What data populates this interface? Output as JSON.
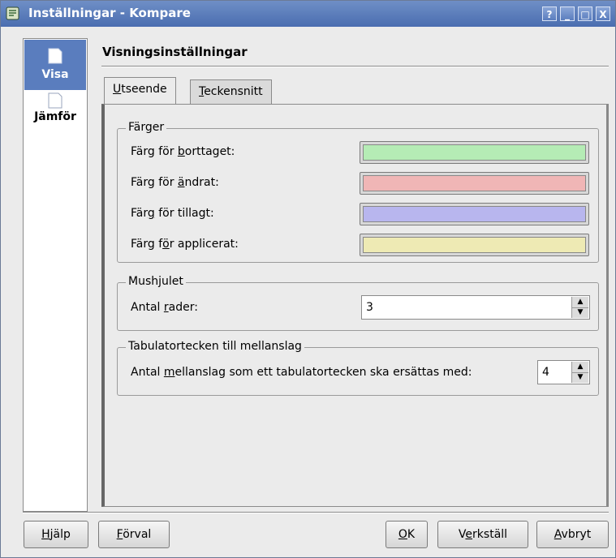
{
  "window": {
    "title": "Inställningar - Kompare",
    "buttons": [
      "?",
      "_",
      "□",
      "X"
    ]
  },
  "sidebar": {
    "items": [
      {
        "label": "Visa",
        "icon": "page-icon",
        "active": true
      },
      {
        "label": "Jämför",
        "icon": "page-icon",
        "active": false
      }
    ]
  },
  "page": {
    "title": "Visningsinställningar"
  },
  "tabs": [
    {
      "label": "Utseende",
      "mnemonic": "U",
      "rest": "tseende",
      "active": true
    },
    {
      "label": "Teckensnitt",
      "mnemonic": "T",
      "rest": "eckensnitt",
      "active": false
    }
  ],
  "colors_group": {
    "title": "Färger",
    "rows": [
      {
        "pre": "Färg för ",
        "mn": "b",
        "post": "orttaget:",
        "color": "#b5ecb5"
      },
      {
        "pre": "Färg för ",
        "mn": "ä",
        "post": "ndrat:",
        "color": "#f0b6b6"
      },
      {
        "pre": "Fär",
        "mn": "g",
        "post": " för tillagt:",
        "color": "#b8b6ee"
      },
      {
        "pre": "Färg f",
        "mn": "ö",
        "post": "r applicerat:",
        "color": "#eeeab4"
      }
    ]
  },
  "mouse_group": {
    "title": "Mushjulet",
    "label_pre": "Antal ",
    "label_mn": "r",
    "label_post": "ader:",
    "value": "3"
  },
  "tab_group": {
    "title": "Tabulatortecken till mellanslag",
    "label_pre": "Antal ",
    "label_mn": "m",
    "label_post": "ellanslag som ett tabulatortecken ska ersättas med:",
    "value": "4"
  },
  "buttons": {
    "help": {
      "mn": "H",
      "post": "jälp"
    },
    "defaults": {
      "mn": "F",
      "post": "örval"
    },
    "ok": {
      "mn": "O",
      "post": "K"
    },
    "apply": {
      "pre": "V",
      "mn": "e",
      "post": "rkställ"
    },
    "cancel": {
      "mn": "A",
      "post": "vbryt"
    }
  }
}
